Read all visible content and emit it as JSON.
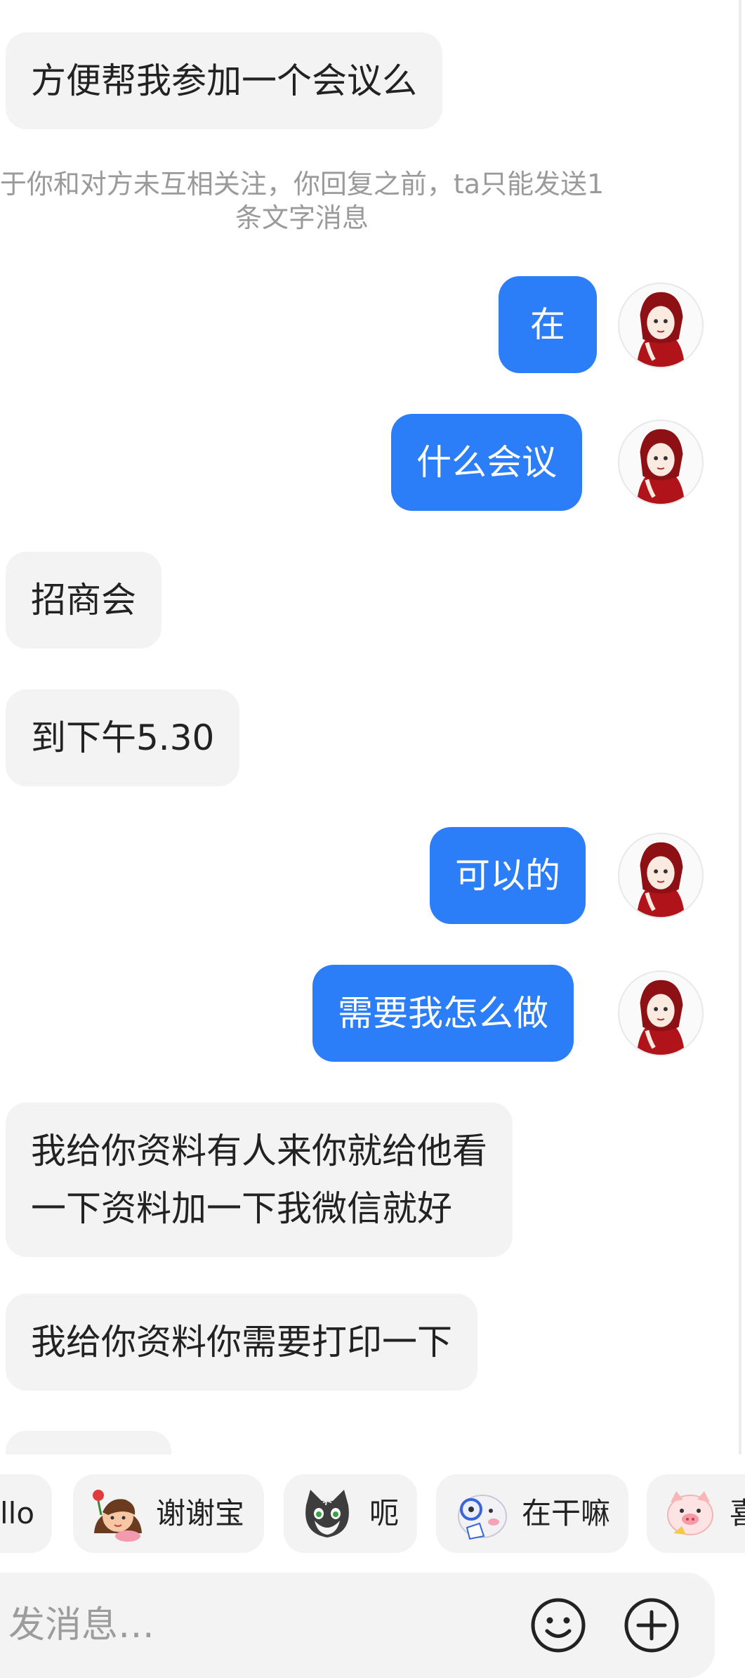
{
  "messages": [
    {
      "side": "in",
      "text": "方便帮我参加一个会议么"
    },
    {
      "side": "out",
      "text": "在"
    },
    {
      "side": "out",
      "text": "什么会议"
    },
    {
      "side": "in",
      "text": "招商会"
    },
    {
      "side": "in",
      "text": "到下午5.30"
    },
    {
      "side": "out",
      "text": "可以的"
    },
    {
      "side": "out",
      "text": "需要我怎么做"
    },
    {
      "side": "in",
      "line1": "我给你资料有人来你就给他看",
      "line2": "一下资料加一下我微信就好"
    },
    {
      "side": "in",
      "text": "我给你资料你需要打印一下"
    }
  ],
  "notice": {
    "line1": "于你和对方未互相关注，你回复之前，ta只能发送1",
    "line2": "条文字消息"
  },
  "quick_replies": [
    {
      "label": "llo"
    },
    {
      "label": "谢谢宝",
      "icon": "flower-girl-sticker-icon"
    },
    {
      "label": "呃",
      "icon": "cat-sticker-icon"
    },
    {
      "label": "在干嘛",
      "icon": "peeking-sticker-icon"
    },
    {
      "label": "喜",
      "icon": "pig-sticker-icon"
    }
  ],
  "input": {
    "placeholder": "发消息…"
  },
  "colors": {
    "out_bubble": "#2b7ef8",
    "in_bubble": "#f3f3f3",
    "notice_text": "#9a9a9a"
  }
}
